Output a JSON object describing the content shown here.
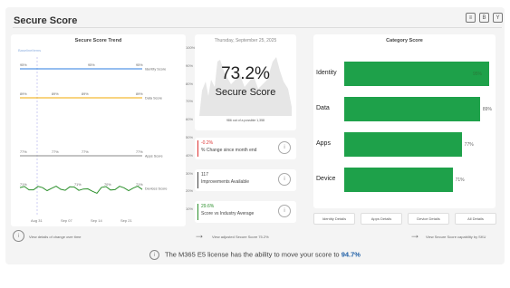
{
  "title": "Secure Score",
  "header_icons": [
    "list-icon",
    "bold-icon",
    "filter-icon"
  ],
  "trend": {
    "title": "Secure Score Trend",
    "legend": "BaselineItems",
    "y_ticks": [
      "100%",
      "90%",
      "80%",
      "70%",
      "60%",
      "50%",
      "40%",
      "30%",
      "20%",
      "10%"
    ],
    "series": [
      {
        "name": "Identity Score",
        "color": "#2b7de0",
        "labels": [
          "95%",
          "95%",
          "95%"
        ]
      },
      {
        "name": "Data Score",
        "color": "#f0a800",
        "labels": [
          "89%",
          "89%",
          "89%",
          "89%"
        ]
      },
      {
        "name": "Apps Score",
        "color": "#8a8a8a",
        "labels": [
          "77%",
          "77%",
          "77%",
          "77%"
        ]
      },
      {
        "name": "Devices Score",
        "color": "#2a8f2a",
        "labels": [
          "71%",
          "71%",
          "70%",
          "71%"
        ]
      }
    ],
    "x_labels": [
      "Aug 31",
      "Sep 07",
      "Sep 14",
      "Sep 21"
    ],
    "footer": "View details of change over time"
  },
  "score": {
    "date": "Thursday, September 25, 2025",
    "value": "73.2%",
    "label": "Secure Score",
    "points": "986 out of a possible 1,358",
    "footer": "View adjusted Secure Score 75.2%"
  },
  "kpis": [
    {
      "value": "-0.2%",
      "label": "% Change since month end",
      "color": "#d33"
    },
    {
      "value": "117",
      "label": "Improvements Available",
      "color": "#444"
    },
    {
      "value": "29.6%",
      "label": "Score vs Industry Average",
      "color": "#2a8f2a"
    }
  ],
  "category": {
    "title": "Category Score",
    "items": [
      {
        "label": "Identity",
        "value": "95%",
        "fraction": 0.95
      },
      {
        "label": "Data",
        "value": "89%",
        "fraction": 0.89
      },
      {
        "label": "Apps",
        "value": "77%",
        "fraction": 0.77
      },
      {
        "label": "Device",
        "value": "71%",
        "fraction": 0.71
      }
    ],
    "buttons": [
      "Identity Details",
      "Apps Details",
      "Device Details",
      "All Details"
    ],
    "footer": "View Secure Score capability by SKU"
  },
  "bottom": {
    "prefix": "The M365 E5 license has the ability to move your score to",
    "value": "94.7%"
  }
}
